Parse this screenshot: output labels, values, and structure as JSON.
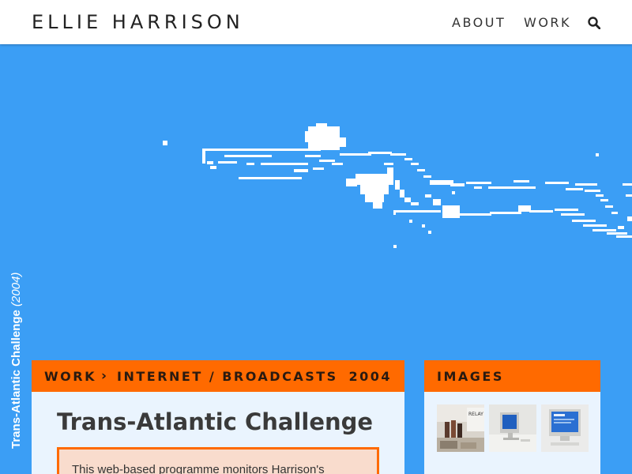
{
  "site": {
    "title": "ELLIE HARRISON",
    "nav": [
      "ABOUT",
      "WORK"
    ],
    "search_icon": "search-icon"
  },
  "hero": {
    "background_color": "#3b9ef5",
    "image_description_icon": "pixel-swimmer-graphic"
  },
  "caption": {
    "title": "Trans-Atlantic Challenge",
    "year": "(2004)"
  },
  "breadcrumb": {
    "section": "WORK",
    "separator": "›",
    "category": "INTERNET / BROADCASTS",
    "year": "2004"
  },
  "project": {
    "title": "Trans-Atlantic Challenge",
    "summary": "This web-based programme monitors Harrison's"
  },
  "images_panel": {
    "heading": "IMAGES",
    "thumbnail_count": 3
  },
  "colors": {
    "accent": "#ff6a00",
    "panel_bg": "#eaf4fe",
    "summary_bg": "#f9dccd"
  }
}
